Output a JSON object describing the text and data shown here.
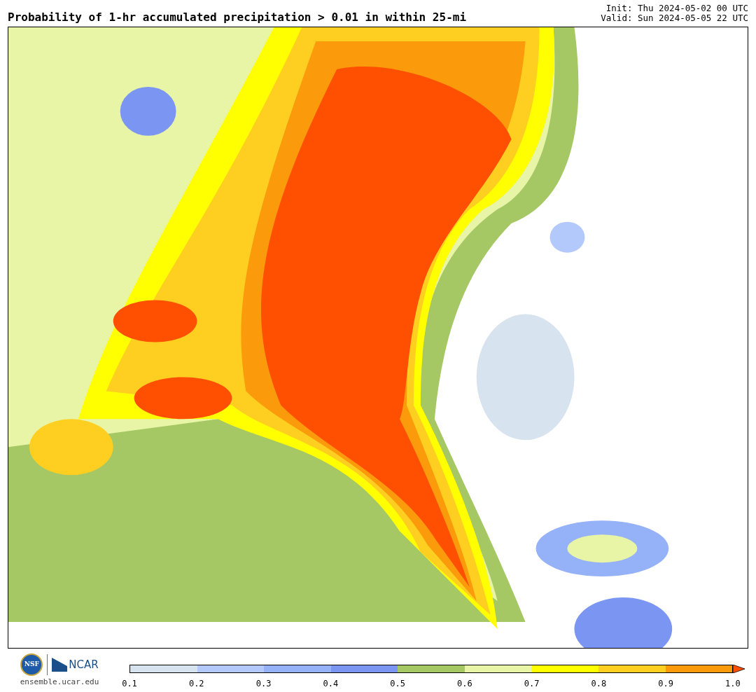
{
  "header": {
    "title": "Probability of 1-hr accumulated precipitation > 0.01 in within 25-mi",
    "init": "Init: Thu 2024-05-02 00 UTC",
    "valid": "Valid: Sun 2024-05-05 22 UTC"
  },
  "footer": {
    "logo_nsf": "NSF",
    "logo_ncar": "NCAR",
    "site": "ensemble.ucar.edu"
  },
  "colorbar": {
    "segments": [
      {
        "color": "#d7e3ee"
      },
      {
        "color": "#b4c9fb"
      },
      {
        "color": "#95b1f7"
      },
      {
        "color": "#7b95f3"
      },
      {
        "color": "#a5c864"
      },
      {
        "color": "#e8f4a6"
      },
      {
        "color": "#ffff00"
      },
      {
        "color": "#fecf21"
      },
      {
        "color": "#fb9a0a"
      }
    ],
    "extension": {
      "color": "#ff4f00"
    },
    "labels": [
      "0.1",
      "0.2",
      "0.3",
      "0.4",
      "0.5",
      "0.6",
      "0.7",
      "0.8",
      "0.9",
      "1.0"
    ]
  }
}
